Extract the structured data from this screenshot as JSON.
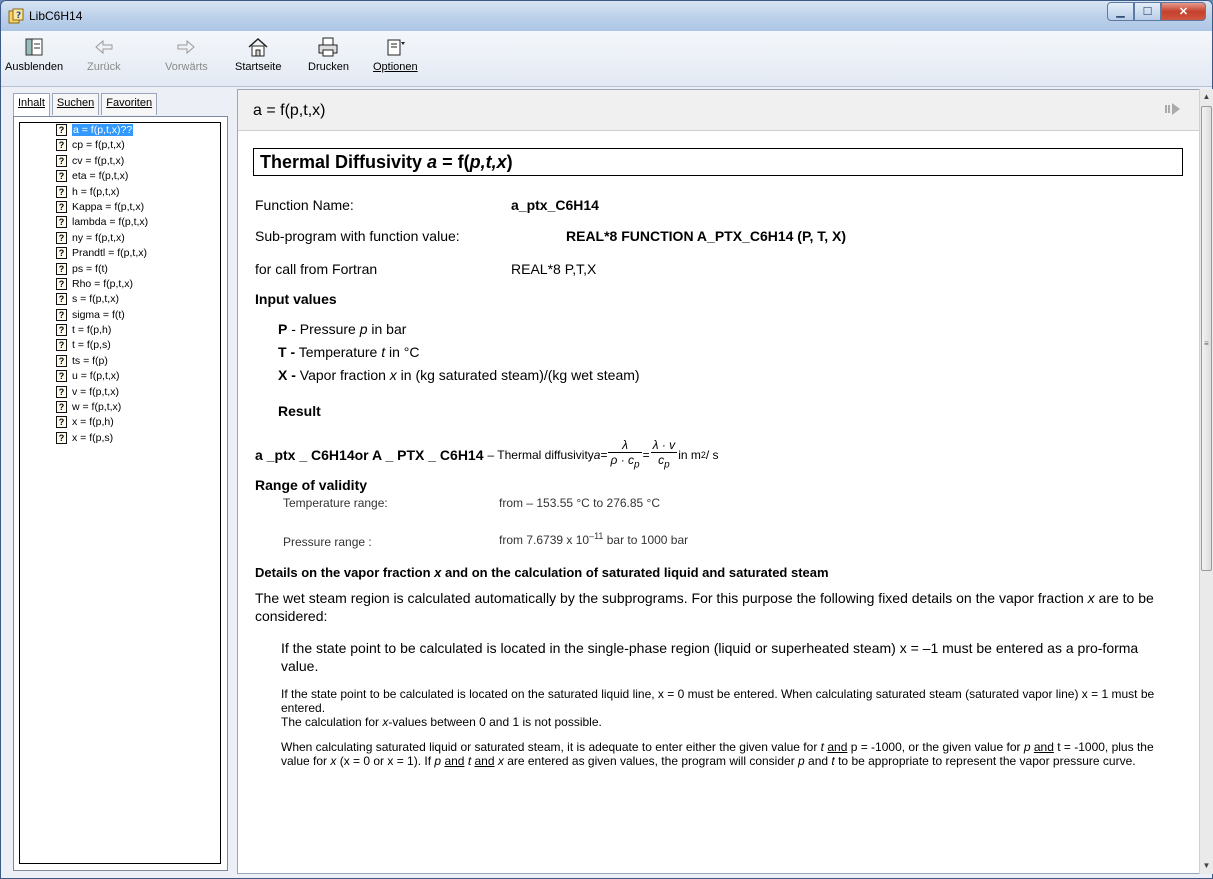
{
  "window": {
    "title": "LibC6H14"
  },
  "toolbar": {
    "hide": "Ausblenden",
    "back": "Zurück",
    "forward": "Vorwärts",
    "home": "Startseite",
    "print": "Drucken",
    "options": "Optionen"
  },
  "nav_tabs": {
    "contents": "Inhalt",
    "search": "Suchen",
    "favorites": "Favoriten"
  },
  "tree": [
    "a = f(p,t,x)??",
    "cp = f(p,t,x)",
    "cv = f(p,t,x)",
    "eta = f(p,t,x)",
    "h = f(p,t,x)",
    "Kappa = f(p,t,x)",
    "lambda = f(p,t,x)",
    "ny = f(p,t,x)",
    "Prandtl = f(p,t,x)",
    "ps = f(t)",
    "Rho = f(p,t,x)",
    "s = f(p,t,x)",
    "sigma = f(t)",
    "t = f(p,h)",
    "t = f(p,s)",
    "ts = f(p)",
    "u = f(p,t,x)",
    "v = f(p,t,x)",
    "w = f(p,t,x)",
    "x = f(p,h)",
    "x = f(p,s)"
  ],
  "page": {
    "header_title": "a = f(p,t,x)",
    "heading_prefix": "Thermal Diffusivity ",
    "heading_var": "a",
    "heading_suffix": " = f(",
    "heading_args": "p,t,x",
    "heading_end": ")",
    "function_name_label": "Function Name:",
    "function_name": "a_ptx_C6H14",
    "subprogram_label": "Sub-program with function value:",
    "subprogram": "REAL*8 FUNCTION A_PTX_C6H14 (P, T, X)",
    "fortran_label": "for call from Fortran",
    "fortran": "REAL*8 P,T,X",
    "input_values": "Input values",
    "p_key": "P",
    "p_text_a": " - Pressure ",
    "p_var": "p",
    "p_text_b": " in bar",
    "t_key": "T -",
    "t_text_a": " Temperature ",
    "t_var": "t",
    "t_text_b": " in °C",
    "x_key": "X -",
    "x_text_a": " Vapor fraction ",
    "x_var": "x",
    "x_text_b": " in (kg saturated steam)/(kg wet steam)",
    "result": "Result",
    "result_names": "a _ptx _ C6H14or  A _ PTX _ C6H14",
    "result_desc": " – Thermal diffusivity ",
    "formula_a": "a",
    "formula_eq": " = ",
    "formula_lambda": "λ",
    "formula_rho_cp": "ρ · c",
    "formula_lambda_v": "λ · v",
    "formula_cp": "c",
    "formula_p": "p",
    "formula_units": " in m",
    "formula_units_sup": "2",
    "formula_units_tail": " / s",
    "range_title": "Range of validity",
    "temp_range_label": "Temperature range:",
    "temp_range": "from  – 153.55 °C to  276.85 °C",
    "pressure_range_label": "Pressure range :",
    "pressure_range_a": "from  7.6739 x 10",
    "pressure_range_exp": "–11",
    "pressure_range_b": " bar to  1000 bar",
    "details_a": "Details on the vapor fraction ",
    "details_var": "x",
    "details_b": " and on the calculation of saturated liquid and saturated steam",
    "wet_a": "The wet steam region is calculated automatically by the subprograms. For this purpose the following fixed details on the vapor fraction ",
    "wet_var": "x",
    "wet_b": " are to be considered:",
    "single_phase": "If the state point to be calculated is located in the single-phase region (liquid or superheated steam) x = –1 must be entered as a pro-forma value.",
    "saturated_a": "If the state point to be calculated is located on the saturated liquid line, x = 0 must be entered. When calculating saturated steam (saturated vapor line) x = 1 must be entered.",
    "saturated_b1": "The calculation for ",
    "saturated_b_var": "x",
    "saturated_b2": "-values between 0 and 1 is not possible.",
    "adequate_1": "When calculating saturated liquid or saturated steam, it is adequate to enter either the given value for ",
    "adequate_t": "t",
    "adequate_and1": "and",
    "adequate_2": " p = -1000, or the given value for ",
    "adequate_p": "p",
    "adequate_and2": "and",
    "adequate_3": " t = -1000, plus the value for ",
    "adequate_x": "x",
    "adequate_4": "  (x = 0 or x = 1). If ",
    "adequate_p2": "p",
    "adequate_and3": "and",
    "adequate_t2": "t",
    "adequate_and4": "and",
    "adequate_x2": "x",
    "adequate_5": " are entered as given values, the program will consider ",
    "adequate_p3": "p",
    "adequate_6": " and ",
    "adequate_t3": "t",
    "adequate_7": " to be appropriate to represent the vapor pressure curve."
  }
}
